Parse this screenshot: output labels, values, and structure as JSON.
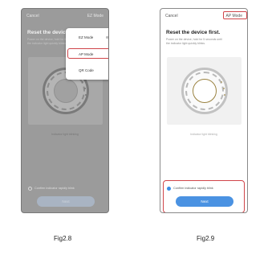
{
  "figure1": {
    "label": "Fig2.8",
    "header": {
      "cancel": "Cancel",
      "mode": "EZ Mode"
    },
    "title": "Reset the device first.",
    "instruction": "Power on the device, hold for 5 seconds until the indicator light quickly blinks.",
    "caption": "Indicator light blinking",
    "confirm": "Confirm indicator rapidly blink",
    "next": "Next",
    "menu": [
      {
        "label": "EZ Mode"
      },
      {
        "label": "AP Mode"
      },
      {
        "label": "QR Code"
      }
    ]
  },
  "figure2": {
    "label": "Fig2.9",
    "header": {
      "cancel": "Cancel",
      "mode": "AP Mode"
    },
    "title": "Reset the device first.",
    "instruction": "Power on the device, hold for 5 seconds until the indicator light quickly blinks.",
    "caption": "Indicator light blinking",
    "confirm": "Confirm indicator rapidly blink",
    "next": "Next"
  }
}
